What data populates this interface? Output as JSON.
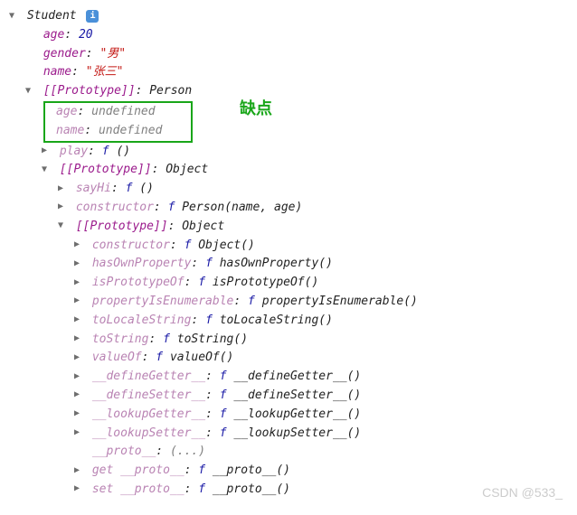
{
  "annotation": "缺点",
  "watermark": "CSDN @533_",
  "glyphs": {
    "open": "▼",
    "closed": "▶",
    "info": "i",
    "ellipsis": "(...)"
  },
  "tree": {
    "root": {
      "type": "Student"
    },
    "own": {
      "age": {
        "value": "20",
        "kind": "num"
      },
      "gender": {
        "value": "\"男\"",
        "kind": "str"
      },
      "name": {
        "value": "\"张三\"",
        "kind": "str"
      }
    },
    "proto1": {
      "label": "[[Prototype]]",
      "type": "Person",
      "props": {
        "age": {
          "value": "undefined",
          "kind": "undef"
        },
        "name": {
          "value": "undefined",
          "kind": "undef"
        },
        "play": {
          "fsig": "()"
        }
      }
    },
    "proto2": {
      "label": "[[Prototype]]",
      "type": "Object",
      "props": {
        "sayHi": {
          "fsig": "()"
        },
        "constructor": {
          "fname": "Person",
          "fsig": "(name, age)"
        }
      }
    },
    "proto3": {
      "label": "[[Prototype]]",
      "type": "Object",
      "props": {
        "constructor": {
          "fname": "Object",
          "fsig": "()"
        },
        "hasOwnProperty": {
          "fname": "hasOwnProperty",
          "fsig": "()"
        },
        "isPrototypeOf": {
          "fname": "isPrototypeOf",
          "fsig": "()"
        },
        "propertyIsEnumerable": {
          "fname": "propertyIsEnumerable",
          "fsig": "()"
        },
        "toLocaleString": {
          "fname": "toLocaleString",
          "fsig": "()"
        },
        "toString": {
          "fname": "toString",
          "fsig": "()"
        },
        "valueOf": {
          "fname": "valueOf",
          "fsig": "()"
        },
        "__defineGetter__": {
          "fname": "__defineGetter__",
          "fsig": "()"
        },
        "__defineSetter__": {
          "fname": "__defineSetter__",
          "fsig": "()"
        },
        "__lookupGetter__": {
          "fname": "__lookupGetter__",
          "fsig": "()"
        },
        "__lookupSetter__": {
          "fname": "__lookupSetter__",
          "fsig": "()"
        },
        "__proto__": {
          "raw": "(...)"
        },
        "get __proto__": {
          "fname": "__proto__",
          "fsig": "()"
        },
        "set __proto__": {
          "fname": "__proto__",
          "fsig": "()"
        }
      }
    }
  }
}
